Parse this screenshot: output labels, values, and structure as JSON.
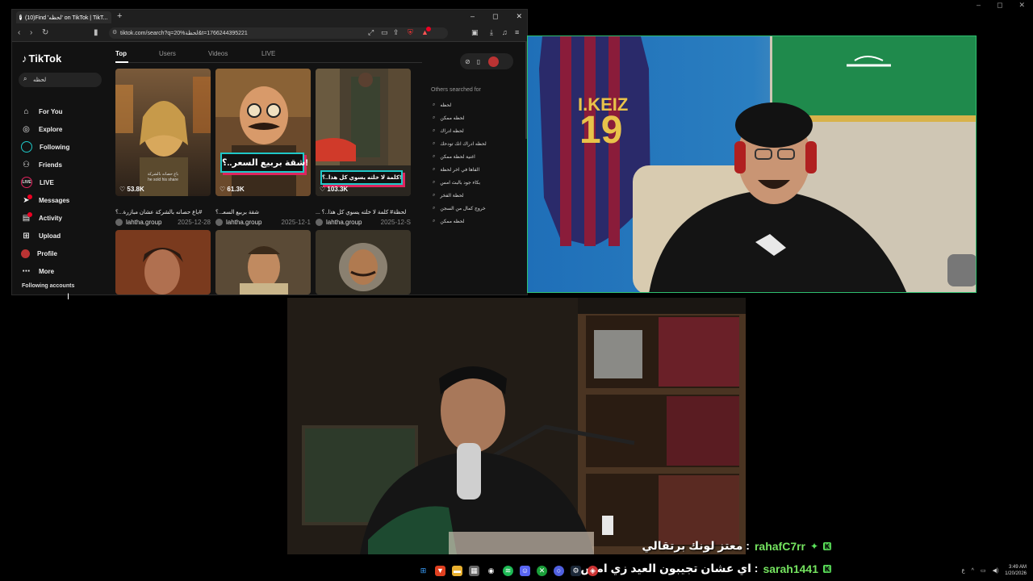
{
  "browser": {
    "tab_title": "(10)Find 'لحظه' on TikTok | TikT...",
    "tab_close": "×",
    "new_tab": "+",
    "url": "tiktok.com/search?q=20%لحظة&t=1766244395221",
    "window_controls": [
      "–",
      "◻",
      "✕"
    ]
  },
  "tiktok": {
    "logo": "TikTok",
    "search_query": "لحظه",
    "nav": [
      {
        "label": "For You",
        "icon": "home-icon"
      },
      {
        "label": "Explore",
        "icon": "compass-icon"
      },
      {
        "label": "Following",
        "icon": "following-icon"
      },
      {
        "label": "Friends",
        "icon": "friends-icon"
      },
      {
        "label": "LIVE",
        "icon": "live-icon"
      },
      {
        "label": "Messages",
        "icon": "messages-icon",
        "badge": "7"
      },
      {
        "label": "Activity",
        "icon": "activity-icon",
        "badge": "3"
      },
      {
        "label": "Upload",
        "icon": "upload-icon"
      },
      {
        "label": "Profile",
        "icon": "profile-icon"
      },
      {
        "label": "More",
        "icon": "more-icon"
      }
    ],
    "following_accounts": "Following accounts",
    "tabs": [
      "Top",
      "Users",
      "Videos",
      "LIVE"
    ],
    "videos": [
      {
        "likes": "53.8K",
        "caption": "#باع حصانه بالشركة عشان مبازرة...؟",
        "author": "lahtha.group",
        "date": "2025-12-28",
        "overlay": "",
        "subtitle": "باع حصانه بالشركة\nhe sold his share"
      },
      {
        "likes": "61.3K",
        "caption": "شقة بربيع السعـ..؟",
        "author": "lahtha.group",
        "date": "2025-12-1",
        "overlay": "شقة بربيع السعر..؟!",
        "subtitle": ""
      },
      {
        "likes": "103.3K",
        "caption": "لحظة# كلمة لا خلته يسوي كل هذا..؟ ...",
        "author": "lahtha.group",
        "date": "2025-12-S",
        "overlay": "كلمة لا خلته يسوي كل هذا..؟!",
        "subtitle": ""
      }
    ],
    "others_title": "Others searched for",
    "others": [
      "لحظه",
      "لحظه ممكن",
      "لحظه ادراك",
      "لحظه ادراك انك تودحك",
      "اغنية لحظة ممكن",
      "الفاها في اخر لحظة",
      "بكاء جود بالبث امس",
      "لحظة الفخر",
      "خروج كمال من السجن",
      "لحظه ممكن"
    ]
  },
  "cam1": {
    "jersey_name": "I.KEIZ",
    "jersey_number": "19"
  },
  "chat": [
    {
      "user": "rahafC7rr",
      "message": "معتز لونك برتقالي :"
    },
    {
      "user": "sarah1441",
      "message": "اي عشان تجيبون العيد زي امس :"
    }
  ],
  "clock": {
    "time": "3:49 AM",
    "date": "1/20/2026"
  },
  "colors": {
    "teal": "#1fc8c8",
    "pink": "#e0245e",
    "chat_green": "#74e35f",
    "cam_border": "#2fbf6f"
  }
}
